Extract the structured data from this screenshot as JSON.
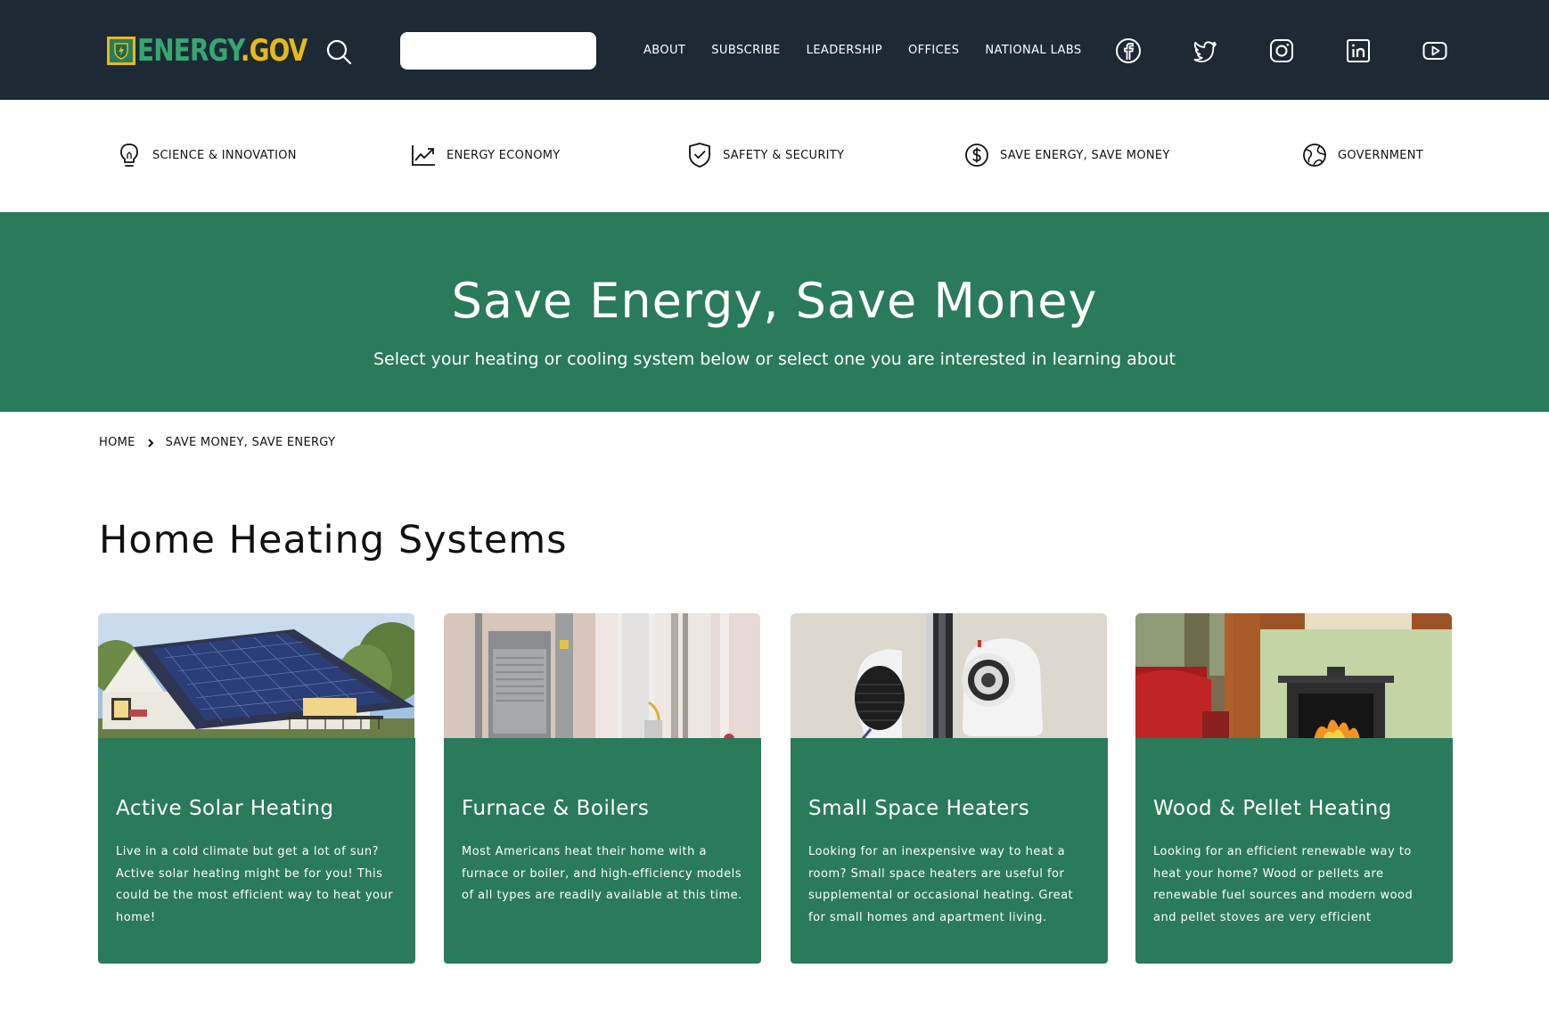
{
  "header": {
    "logo": {
      "part1": "ENERGY",
      "part2": ".GOV"
    },
    "search": {
      "placeholder": ""
    },
    "nav": [
      "ABOUT",
      "SUBSCRIBE",
      "LEADERSHIP",
      "OFFICES",
      "NATIONAL LABS"
    ],
    "social_icons": [
      "facebook-icon",
      "twitter-icon",
      "instagram-icon",
      "linkedin-icon",
      "youtube-icon"
    ]
  },
  "subnav": {
    "items": [
      {
        "label": "SCIENCE & INNOVATION",
        "icon": "lightbulb-icon"
      },
      {
        "label": "ENERGY ECONOMY",
        "icon": "chart-line-icon"
      },
      {
        "label": "SAFETY & SECURITY",
        "icon": "shield-check-icon"
      },
      {
        "label": "SAVE ENERGY, SAVE MONEY",
        "icon": "dollar-circle-icon"
      },
      {
        "label": "GOVERNMENT",
        "icon": "globe-icon"
      }
    ]
  },
  "hero": {
    "title": "Save Energy, Save Money",
    "subtitle": "Select your heating or cooling system below or select one you are interested in learning about"
  },
  "breadcrumb": {
    "home": "HOME",
    "current": "SAVE MONEY, SAVE ENERGY"
  },
  "section": {
    "title": "Home Heating Systems"
  },
  "cards": [
    {
      "title": "Active Solar Heating",
      "text": "Live in a cold climate but get a lot of sun? Active solar heating might be for you! This could be the most efficient way to heat your home!"
    },
    {
      "title": "Furnace & Boilers",
      "text": "Most Americans heat their home with a furnace or boiler, and high-efficiency models of all types are readily available at this time."
    },
    {
      "title": "Small Space Heaters",
      "text": "Looking for an inexpensive way to heat a room? Small space heaters are useful for supplemental or occasional heating. Great for small homes and apartment living."
    },
    {
      "title": "Wood & Pellet Heating",
      "text": "Looking for an efficient renewable way to heat your home? Wood or pellets are renewable fuel sources and modern wood and pellet stoves are very efficient"
    }
  ],
  "colors": {
    "topbar": "#1d2a35",
    "brand_green": "#2a7a5c",
    "logo_green": "#35a772",
    "logo_gold": "#e8b91a"
  }
}
